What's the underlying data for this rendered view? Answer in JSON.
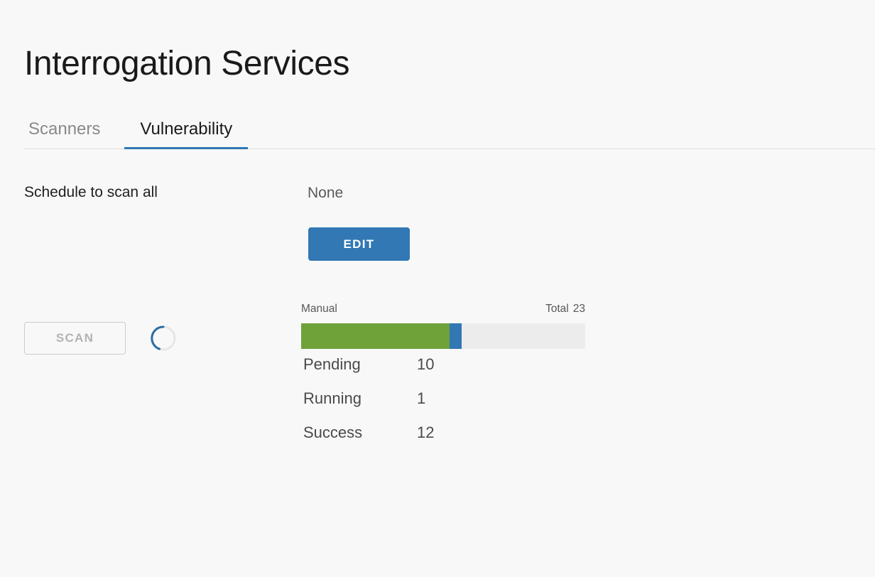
{
  "page": {
    "title": "Interrogation Services",
    "background_color": "#f8f8f8",
    "accent_color": "#3178b4"
  },
  "tabs": [
    {
      "label": "Scanners",
      "active": false
    },
    {
      "label": "Vulnerability",
      "active": true
    }
  ],
  "schedule": {
    "label": "Schedule to scan all",
    "value": "None",
    "edit_label": "EDIT"
  },
  "scan": {
    "button_label": "SCAN",
    "spinner_icon": "loading-spinner-icon"
  },
  "progress": {
    "mode_label": "Manual",
    "total_label": "Total",
    "total_value": "23",
    "track_color": "#ececec",
    "segments": [
      {
        "name": "success",
        "color": "#6fa239",
        "percent": 52.2
      },
      {
        "name": "running",
        "color": "#3178b4",
        "percent": 4.3
      }
    ]
  },
  "statuses": [
    {
      "label": "Pending",
      "count": "10"
    },
    {
      "label": "Running",
      "count": "1"
    },
    {
      "label": "Success",
      "count": "12"
    }
  ]
}
